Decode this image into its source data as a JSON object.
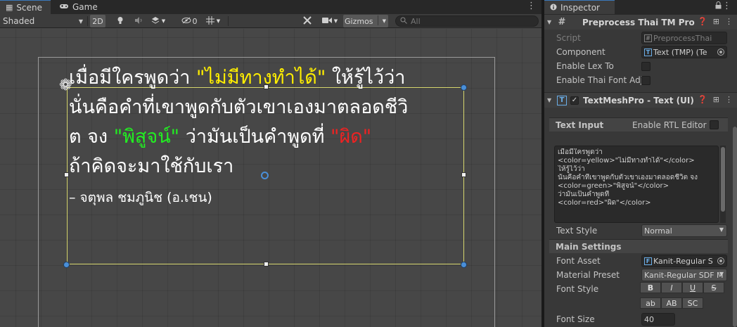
{
  "scene_tabs": [
    {
      "label": "Scene",
      "icon": "grid-icon"
    },
    {
      "label": "Game",
      "icon": "gamepad-icon"
    }
  ],
  "toolbar": {
    "shading_mode": "Shaded",
    "two_d": "2D",
    "hidden_count": "0",
    "gizmos": "Gizmos",
    "search_placeholder": "All"
  },
  "scene_text": {
    "line1_a": "เมื่อมีใครพูดว่า ",
    "line1_yellow": "\"ไม่มีทางทำได้\"",
    "line1_b": " ให้รู้ไว้ว่า",
    "line2": "นั่นคือคำที่เขาพูดกับตัวเขาเองมาตลอดชีวิ",
    "line3_a": "ต จง ",
    "line3_green": "\"พิสูจน์\"",
    "line3_b": " ว่ามันเป็นคำพูดที่ ",
    "line3_red": "\"ผิด\"",
    "line4": "ถ้าคิดจะมาใช้กับเรา",
    "line5": "– จตุพล ชมภูนิช (อ.เชน)"
  },
  "inspector": {
    "tab_label": "Inspector",
    "preprocess": {
      "title": "Preprocess Thai TM Pro",
      "script_label": "Script",
      "script_value": "PreprocessThai",
      "component_label": "Component",
      "component_value": "Text (TMP) (Te",
      "enable_lexto_label": "Enable Lex To",
      "enable_font_label": "Enable Thai Font Adju"
    },
    "textmesh": {
      "title": "TextMeshPro - Text (UI)",
      "text_input_label": "Text Input",
      "rtl_label": "Enable RTL Editor",
      "text_lines": [
        "เมื่อมีใครพูดว่า",
        "<color=yellow>\"ไม่มีทางทำได้\"</color>",
        "ให้รู้ไว้ว่า",
        "นั่นคือคำที่เขาพูดกับตัวเขาเองมาตลอดชีวิต จง",
        "<color=green>\"พิสูจน์\"</color>",
        "ว่ามันเป็นคำพูดที่",
        "<color=red>\"ผิด\"</color>"
      ],
      "text_style_label": "Text Style",
      "text_style_value": "Normal",
      "main_settings_label": "Main Settings",
      "font_asset_label": "Font Asset",
      "font_asset_value": "Kanit-Regular S",
      "material_preset_label": "Material Preset",
      "material_preset_value": "Kanit-Regular SDF M",
      "font_style_label": "Font Style",
      "font_style_buttons_row1": [
        "B",
        "I",
        "U",
        "S"
      ],
      "font_style_buttons_row2": [
        "ab",
        "AB",
        "SC"
      ],
      "font_size_label": "Font Size",
      "font_size_value": "40"
    }
  },
  "colors": {
    "accent_blue": "#4a8fd8",
    "text_yellow": "#ffee00",
    "text_green": "#22ee22",
    "text_red": "#ee2222",
    "selection_yellow": "#d6d66e"
  }
}
